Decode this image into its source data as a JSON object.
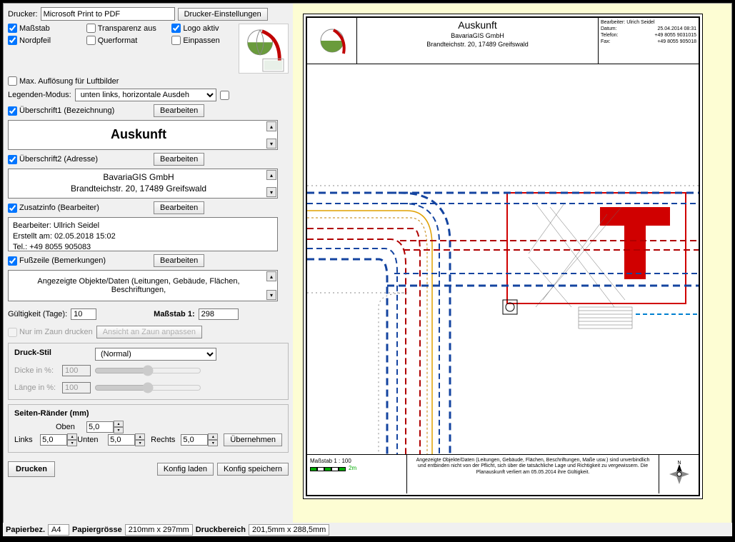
{
  "printer": {
    "label": "Drucker:",
    "value": "Microsoft Print to PDF",
    "settings_btn": "Drucker-Einstellungen"
  },
  "options": {
    "massstab": "Maßstab",
    "transparenz": "Transparenz aus",
    "logo_aktiv": "Logo aktiv",
    "nordpfeil": "Nordpfeil",
    "querformat": "Querformat",
    "einpassen": "Einpassen",
    "max_aufloesung": "Max. Auflösung für Luftbilder"
  },
  "legend": {
    "label": "Legenden-Modus:",
    "value": "unten links, horizontale Ausdeh"
  },
  "sections": {
    "ueberschrift1": {
      "label": "Überschrift1 (Bezeichnung)",
      "btn": "Bearbeiten",
      "value": "Auskunft"
    },
    "ueberschrift2": {
      "label": "Überschrift2 (Adresse)",
      "btn": "Bearbeiten",
      "line1": "BavariaGIS GmbH",
      "line2": "Brandteichstr. 20, 17489 Greifswald"
    },
    "zusatzinfo": {
      "label": "Zusatzinfo (Bearbeiter)",
      "btn": "Bearbeiten",
      "line1": "Bearbeiter: Ullrich Seidel",
      "line2": "Erstellt am: 02.05.2018 15:02",
      "line3": "Tel.: +49 8055 905083"
    },
    "fusszeile": {
      "label": "Fußzeile (Bemerkungen)",
      "btn": "Bearbeiten",
      "text": "Angezeigte Objekte/Daten (Leitungen, Gebäude, Flächen, Beschriftungen,"
    }
  },
  "gueltigkeit": {
    "label": "Gültigkeit (Tage):",
    "value": "10"
  },
  "massstab_input": {
    "label": "Maßstab 1:",
    "value": "298"
  },
  "nur_zaun": "Nur im Zaun drucken",
  "ansicht_zaun": "Ansicht an Zaun anpassen",
  "druckstil": {
    "title": "Druck-Stil",
    "select": "(Normal)",
    "dicke_label": "Dicke in %:",
    "dicke_value": "100",
    "laenge_label": "Länge in %:",
    "laenge_value": "100"
  },
  "raender": {
    "title": "Seiten-Ränder (mm)",
    "links_label": "Links",
    "links_value": "5,0",
    "oben_label": "Oben",
    "oben_value": "5,0",
    "unten_label": "Unten",
    "unten_value": "5,0",
    "rechts_label": "Rechts",
    "rechts_value": "5,0",
    "btn": "Übernehmen"
  },
  "buttons": {
    "drucken": "Drucken",
    "konfig_laden": "Konfig laden",
    "konfig_speichern": "Konfig speichern"
  },
  "status": {
    "papierbez_label": "Papierbez.",
    "papierbez_value": "A4",
    "papiergroesse_label": "Papiergrösse",
    "papiergroesse_value": "210mm x 297mm",
    "druckbereich_label": "Druckbereich",
    "druckbereich_value": "201,5mm x 288,5mm"
  },
  "preview": {
    "title": "Auskunft",
    "subtitle1": "BavariaGIS GmbH",
    "subtitle2": "Brandteichstr. 20, 17489 Greifswald",
    "meta_bearbeiter_l": "Bearbeiter:",
    "meta_bearbeiter_v": "Ulrich Seidel",
    "meta_datum_l": "Datum:",
    "meta_datum_v": "25.04.2014 08:31",
    "meta_telefon_l": "Telefon:",
    "meta_telefon_v": "+49 8055 9031015",
    "meta_fax_l": "Fax:",
    "meta_fax_v": "+49 8055 905018",
    "scale_label": "Maßstab 1 : 100",
    "scale_dist": "2m",
    "disclaimer": "Angezeigte Objekte/Daten (Leitungen, Gebäude, Flächen, Beschriftungen, Maße usw.) sind unverbindlich und entbinden nicht von der Pflicht, sich über die tatsächliche Lage und Richtigkeit zu vergewissern. Die Planauskunft verliert am 05.05.2014 ihre Gültigkeit.",
    "compass_n": "N"
  }
}
